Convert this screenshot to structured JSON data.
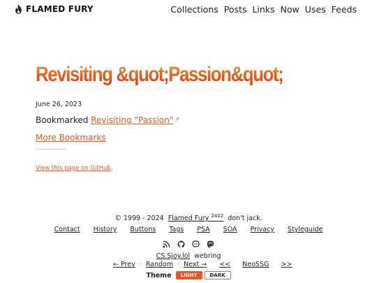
{
  "brand": {
    "name": "FLAMED FURY"
  },
  "nav": [
    "Collections",
    "Posts",
    "Links",
    "Now",
    "Uses",
    "Feeds"
  ],
  "post": {
    "title": "Revisiting &quot;Passion&quot;",
    "date": "June 26, 2023",
    "bookmark_prefix": "Bookmarked",
    "bookmark_link": "Revisiting \"Passion\"",
    "external_mark": "↗",
    "more_link": "More Bookmarks",
    "github_link": "View this page on GitHub",
    "github_suffix": "."
  },
  "footer": {
    "copyright": "© 1999 - 2024",
    "owner": "Flamed Fury",
    "version": "2402",
    "tagline": "don't jack.",
    "links": [
      "Contact",
      "History",
      "Buttons",
      "Tags",
      "PSA",
      "SOA",
      "Privacy",
      "Styleguide"
    ],
    "icons": [
      "rss-icon",
      "github-icon",
      "discord-icon",
      "mastodon-icon"
    ],
    "webring_name": "CS.Sjoy.lol",
    "webring_word": "webring",
    "webring_prev": "← Prev",
    "webring_random": "Random",
    "webring_next": "Next →",
    "webring_dot": "·",
    "ring2_prev": "<<",
    "ring2_name": "NeoSSG",
    "ring2_next": ">>",
    "theme_label": "Theme",
    "theme_light": "LIGHT",
    "theme_dark": "DARK"
  },
  "colors": {
    "accent": "#e8591f"
  }
}
